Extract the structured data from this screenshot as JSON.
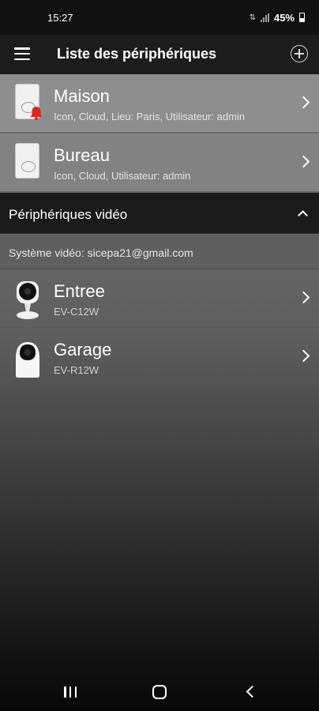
{
  "status_bar": {
    "time": "15:27",
    "battery": "45%"
  },
  "app_bar": {
    "title": "Liste des périphériques",
    "menu_icon": "menu-icon",
    "add_icon": "add-circle-icon"
  },
  "alarm_devices": [
    {
      "name": "Maison",
      "details": "Icon, Cloud, Lieu: Paris, Utilisateur: admin",
      "icon": "alarm-panel-icon",
      "alert": true,
      "alert_color": "#e0241b"
    },
    {
      "name": "Bureau",
      "details": "Icon, Cloud, Utilisateur: admin",
      "icon": "alarm-panel-icon",
      "alert": false
    }
  ],
  "video_section": {
    "title": "Périphériques vidéo",
    "account": "Système vidéo: sicepa21@gmail.com",
    "cameras": [
      {
        "name": "Entree",
        "model": "EV-C12W",
        "icon": "cube-camera-icon"
      },
      {
        "name": "Garage",
        "model": "EV-R12W",
        "icon": "dome-camera-icon"
      }
    ]
  },
  "colors": {
    "alert_bell": "#e0241b",
    "app_bar_bg": "#1c1c1c"
  }
}
